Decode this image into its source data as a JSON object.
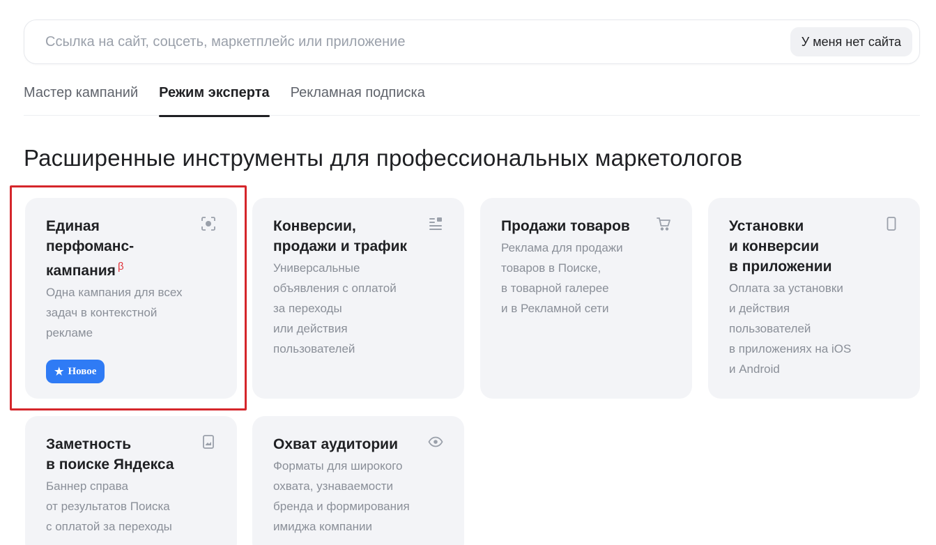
{
  "search": {
    "placeholder": "Ссылка на сайт, соцсеть, маркетплейс или приложение",
    "value": "",
    "no_site_label": "У меня нет сайта"
  },
  "tabs": [
    {
      "label": "Мастер кампаний",
      "active": false
    },
    {
      "label": "Режим эксперта",
      "active": true
    },
    {
      "label": "Рекламная подписка",
      "active": false
    }
  ],
  "section": {
    "title": "Расширенные инструменты для профессиональных маркетологов"
  },
  "cards": [
    {
      "title": "Единая\nперфоманс-\nкампания",
      "beta": "β",
      "description": "Одна кампания для всех\nзадач в контекстной\nрекламе",
      "badge": "Новое",
      "icon": "target-scan-icon",
      "highlighted": true
    },
    {
      "title": "Конверсии,\nпродажи и трафик",
      "description": "Универсальные\nобъявления с оплатой\nза переходы\nили действия\nпользователей",
      "icon": "text-image-icon"
    },
    {
      "title": "Продажи товаров",
      "description": "Реклама для продажи\nтоваров в Поиске,\nв товарной галерее\nи в Рекламной сети",
      "icon": "cart-icon"
    },
    {
      "title": "Установки\nи конверсии\nв приложении",
      "description": "Оплата за установки\nи действия\nпользователей\nв приложениях на iOS\nи Android",
      "icon": "phone-icon"
    },
    {
      "title": "Заметность\nв поиске Яндекса",
      "description": "Баннер справа\nот результатов Поиска\nс оплатой за переходы",
      "icon": "banner-image-icon"
    },
    {
      "title": "Охват аудитории",
      "description": "Форматы для широкого\nохвата, узнаваемости\nбренда и формирования\nимиджа компании",
      "icon": "eye-icon"
    }
  ],
  "colors": {
    "accent": "#2f7bf5",
    "highlight": "#d5262b",
    "card_bg": "#f3f4f7",
    "beta": "#e0323a"
  }
}
